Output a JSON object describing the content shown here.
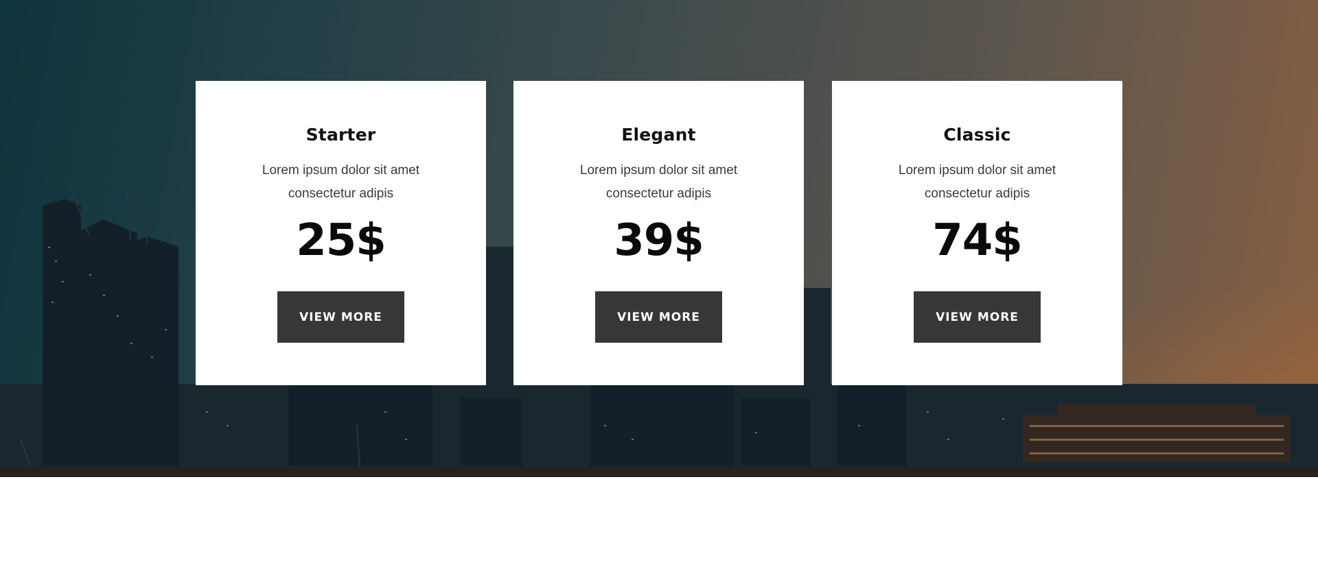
{
  "pricing": {
    "plans": [
      {
        "name": "Starter",
        "description_line1": "Lorem ipsum dolor sit amet",
        "description_line2": "consectetur adipis",
        "price": "25$",
        "button_label": "VIEW MORE"
      },
      {
        "name": "Elegant",
        "description_line1": "Lorem ipsum dolor sit amet",
        "description_line2": "consectetur adipis",
        "price": "39$",
        "button_label": "VIEW MORE"
      },
      {
        "name": "Classic",
        "description_line1": "Lorem ipsum dolor sit amet",
        "description_line2": "consectetur adipis",
        "price": "74$",
        "button_label": "VIEW MORE"
      }
    ]
  },
  "colors": {
    "card_background": "#ffffff",
    "button_background": "#373737",
    "button_text": "#ffffff",
    "title_text": "#111111"
  }
}
